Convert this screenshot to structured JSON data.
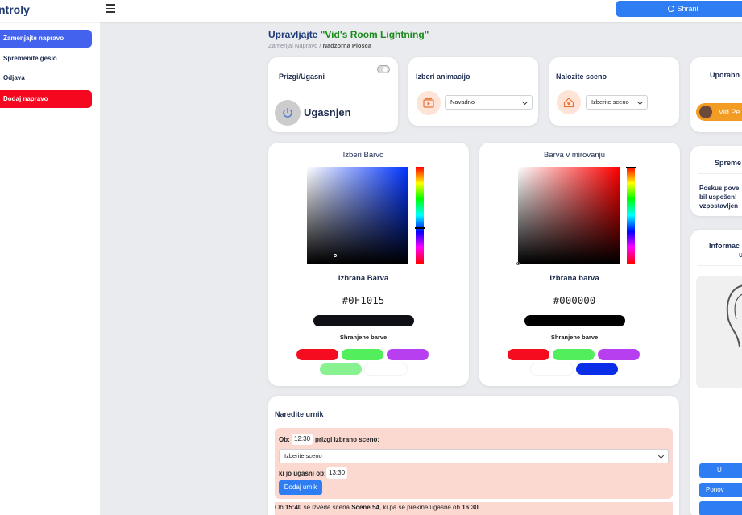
{
  "app": {
    "brand": "ntroly"
  },
  "topbar": {
    "save_label": "Shrani"
  },
  "sidebar": {
    "items": [
      {
        "label": "Zamenjajte napravo",
        "state": "active"
      },
      {
        "label": "Spremenite geslo",
        "state": "normal"
      },
      {
        "label": "Odjava",
        "state": "normal"
      },
      {
        "label": "Dodaj napravo",
        "state": "danger"
      }
    ]
  },
  "header": {
    "title_prefix": "Upravljajte ",
    "device_name": "\"Vid's Room Lightning\"",
    "breadcrumb_link": "Zamenjaj Napravo",
    "breadcrumb_sep": "/",
    "breadcrumb_current": "Nadzorna Plosca"
  },
  "power_card": {
    "title": "Prizgi/Ugasni",
    "status": "Ugasnjen",
    "toggle_on": false
  },
  "animation_card": {
    "title": "Izberi animacijo",
    "selected": "Navadno"
  },
  "scene_card": {
    "title": "Nalozite sceno",
    "selected": "Izberite sceno"
  },
  "users_card": {
    "title": "Uporabn",
    "user_name": "Vid Pe"
  },
  "color_card": {
    "title": "Izberi Barvo",
    "selected_label": "Izbrana Barva",
    "hex": "#0F1015",
    "hue": "#0033ff",
    "saved_label": "Shranjene barve",
    "saved": [
      "#f50d1f",
      "#52ee5c",
      "#b83ff0",
      "#87f28f",
      "#ffffff"
    ]
  },
  "idle_card": {
    "title": "Barva v mirovanju",
    "selected_label": "Izbrana barva",
    "hex": "#000000",
    "hue": "#ff0000",
    "saved_label": "Shranjene barve",
    "saved": [
      "#f50d1f",
      "#52ee5c",
      "#b83ff0",
      "#ffffff",
      "#0a2ee8"
    ]
  },
  "spremembe_card": {
    "title": "Spreme",
    "text1": "Poskus pove",
    "text2": "bil uspešen!",
    "text3": "vzpostavljen"
  },
  "info_card": {
    "title1": "Informac",
    "title2": "u"
  },
  "right_buttons": [
    "U",
    "Ponov",
    ""
  ],
  "schedule": {
    "title": "Naredite urnik",
    "ob_label": "Ob:",
    "start_time": "12:30",
    "start_text": "prizgi izbrano sceno:",
    "scene_select": "Izberite sceno",
    "off_label": "ki jo ugasni ob:",
    "end_time": "13:30",
    "add_button": "Dodaj urnik",
    "entry": {
      "p1": "Ob ",
      "t1": "15:40",
      "p2": " se izvede scena ",
      "scene": "Scene 54",
      "p3": ", ki pa se prekine/ugasne ob ",
      "t2": "16:30"
    }
  }
}
